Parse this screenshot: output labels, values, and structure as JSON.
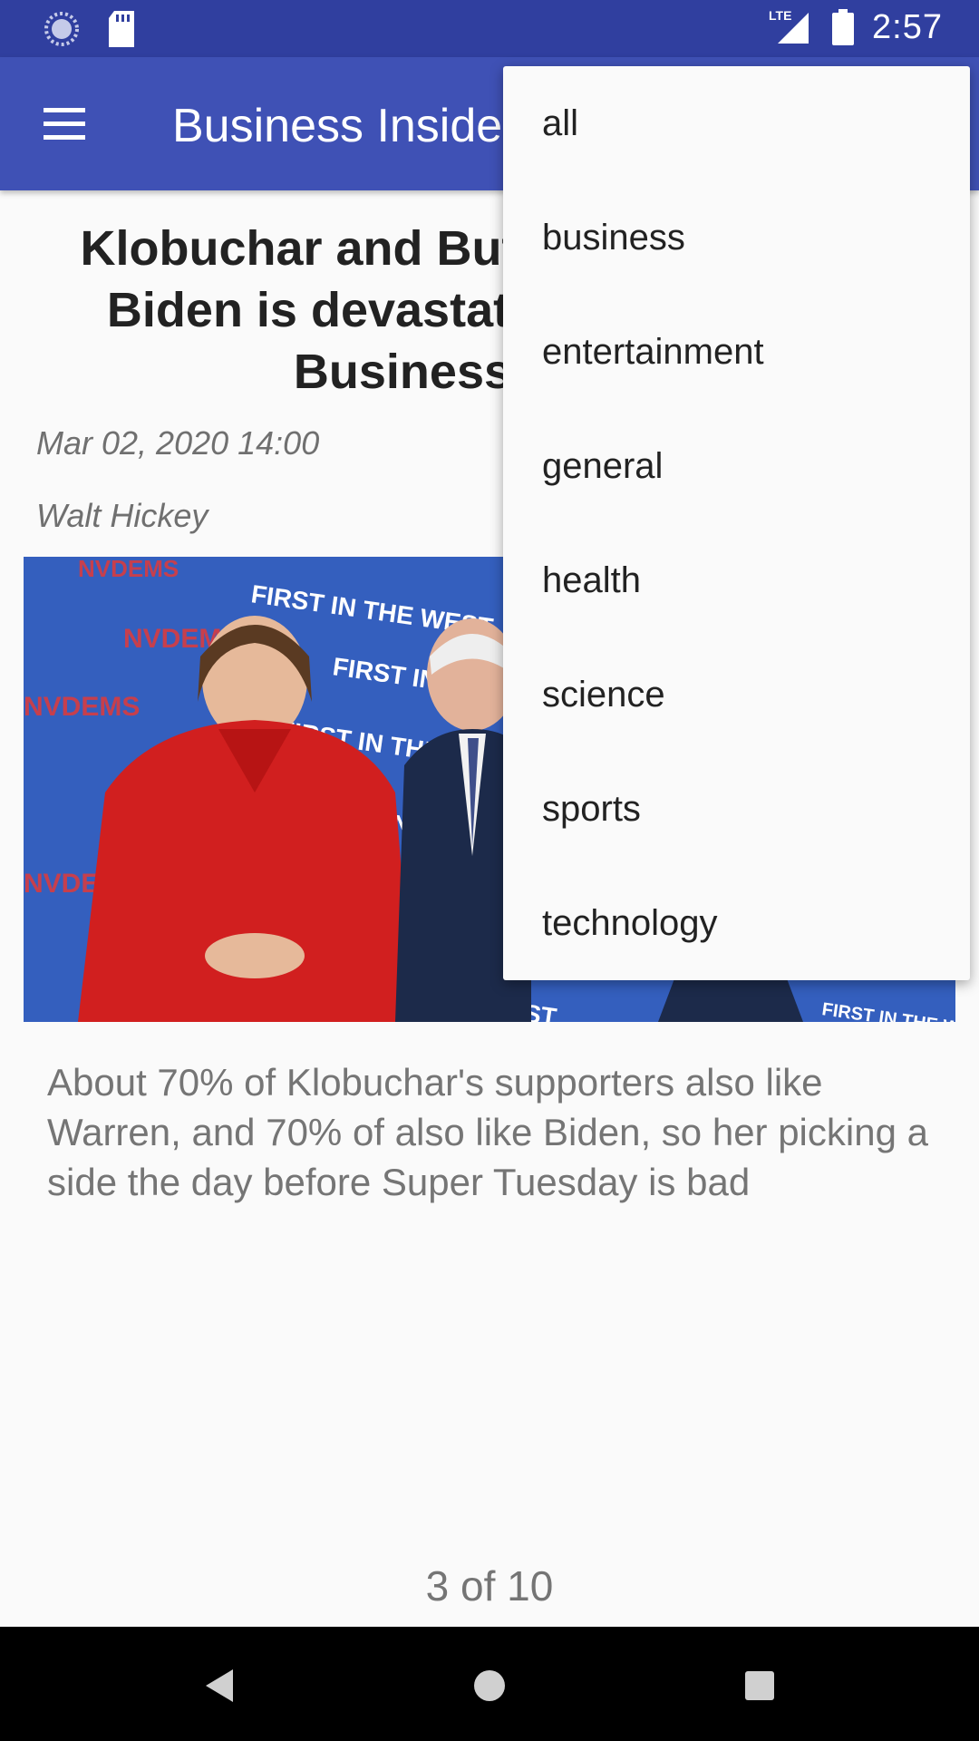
{
  "status_bar": {
    "time": "2:57",
    "network": "LTE",
    "icons": [
      "sync-icon",
      "sd-card-icon",
      "lte-signal-icon",
      "battery-icon"
    ]
  },
  "app_bar": {
    "title": "Business Insider",
    "menu_icon": "hamburger-menu-icon",
    "background": "#3f51b5"
  },
  "article": {
    "headline_lines": [
      "Klobuchar and Buttigieg endorsing",
      "Biden is devastating for Warren -",
      "Business Insider"
    ],
    "date": "Mar 02, 2020 14:00",
    "author": "Walt Hickey",
    "image_banner_texts": [
      "FIRST IN THE WEST",
      "NVDEMS"
    ],
    "description": "About 70% of Klobuchar's supporters also like Warren, and 70% of also like Biden, so her picking a side the day before Super Tuesday is bad"
  },
  "pagination": {
    "label": "3 of 10"
  },
  "dropdown": {
    "items": [
      "all",
      "business",
      "entertainment",
      "general",
      "health",
      "science",
      "sports",
      "technology"
    ]
  },
  "nav_bar": {
    "icons": [
      "back-icon",
      "home-icon",
      "recents-icon"
    ]
  }
}
